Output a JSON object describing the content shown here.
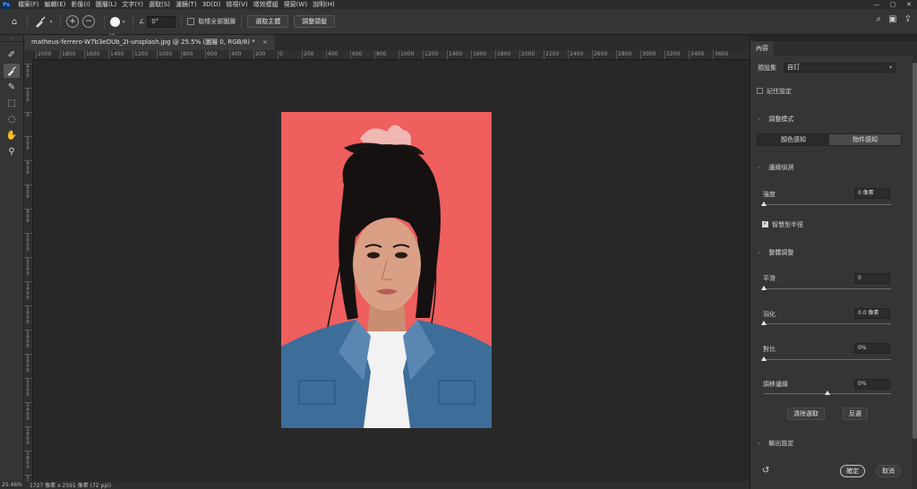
{
  "menu": {
    "logo": "Ps",
    "items": [
      "檔案(F)",
      "編輯(E)",
      "影像(I)",
      "圖層(L)",
      "文字(Y)",
      "選取(S)",
      "濾鏡(T)",
      "3D(D)",
      "檢視(V)",
      "增效模組",
      "視窗(W)",
      "說明(H)"
    ]
  },
  "options": {
    "brush_size": "40",
    "angle_value": "0°",
    "sample_all_layers_label": "取樣全部圖層",
    "select_subject_label": "選取主體",
    "refine_label": "調整頭髮"
  },
  "tab": {
    "filename": "matheus-ferrero-W7b3eDUb_2I-unsplash.jpg @ 25.5% (圖層 0, RGB/8) *",
    "close": "×"
  },
  "ruler": {
    "top_labels": [
      "2000",
      "1800",
      "1600",
      "1400",
      "1200",
      "1000",
      "800",
      "600",
      "400",
      "200",
      "0",
      "200",
      "400",
      "600",
      "800",
      "1000",
      "1200",
      "1400",
      "1600",
      "1800",
      "2000",
      "2200",
      "2400",
      "2600",
      "2800",
      "3000",
      "3200",
      "3400",
      "3600"
    ],
    "left_labels": [
      "400",
      "200",
      "0",
      "200",
      "400",
      "600",
      "800",
      "1000",
      "1200",
      "1400",
      "1600",
      "1800",
      "2000",
      "2200",
      "2400",
      "2600",
      "2800",
      "3000"
    ]
  },
  "status": {
    "zoom": "25.46%",
    "doc_info": "1727 像素 x 2591 像素 (72 ppi)"
  },
  "panel": {
    "tab_label": "內容",
    "preset_label": "預設集",
    "preset_value": "自訂",
    "remember_label": "記住設定",
    "view_mode_section": "調整模式",
    "mode_color": "顏色感知",
    "mode_object": "物件感知",
    "edge_section": "邊緣偵測",
    "radius_label": "強度",
    "radius_value": "0 像素",
    "radius_slider": 0,
    "smart_radius_label": "智慧型半徑",
    "global_section": "整體調整",
    "smooth_label": "平滑",
    "smooth_value": "0",
    "smooth_slider": 0,
    "feather_label": "羽化",
    "feather_value": "0.0 像素",
    "feather_slider": 0,
    "contrast_label": "對比",
    "contrast_value": "0%",
    "contrast_slider": 0,
    "shift_label": "調移邊緣",
    "shift_value": "0%",
    "shift_slider": 0.5,
    "clear_btn": "清除選取",
    "invert_btn": "反選",
    "output_section": "輸出設定",
    "ok_btn": "確定",
    "cancel_btn": "取消"
  },
  "colors": {
    "photo_bg": "#ee5f5e",
    "accent": "#0e2f5a"
  }
}
